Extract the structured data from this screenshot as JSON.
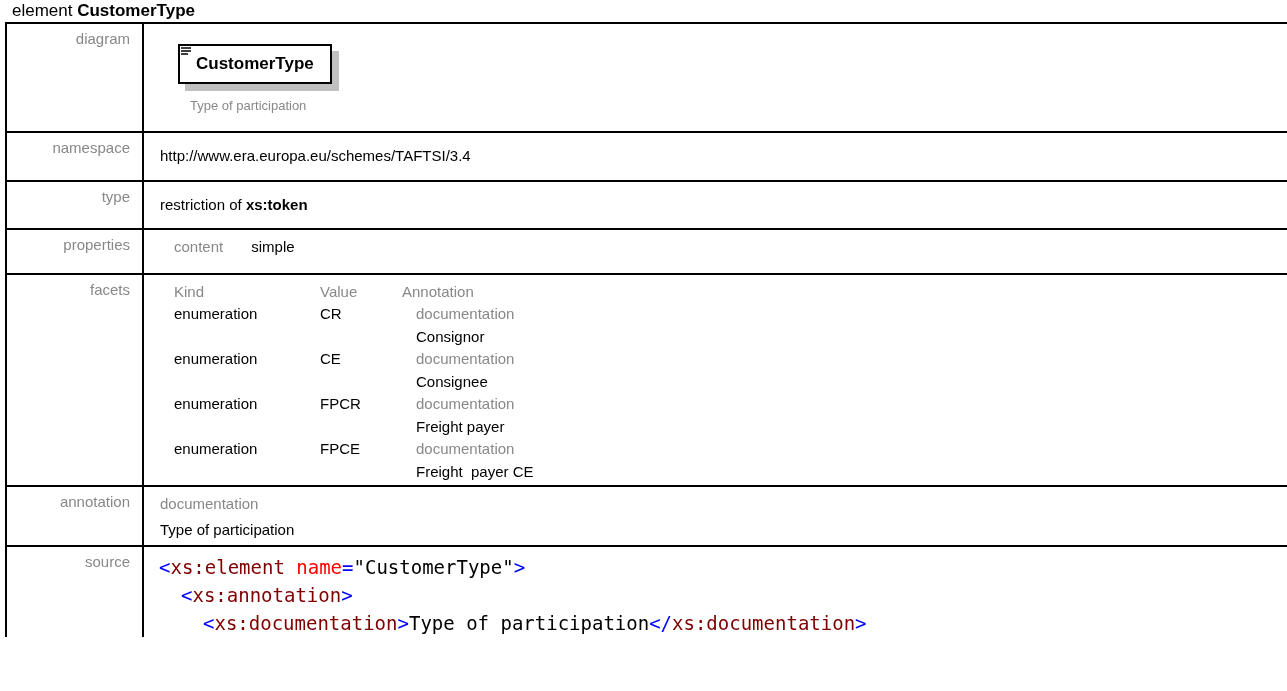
{
  "heading": "element **CustomerType**",
  "rows": [
    {
      "kind": "diagram",
      "label": "diagram",
      "element": "CustomerType",
      "caption": "Type of participation"
    },
    {
      "kind": "text",
      "label": "namespace",
      "value": "http://www.era.europa.eu/schemes/TAFTSI/3.4"
    },
    {
      "kind": "text",
      "label": "type",
      "value": "restriction of **xs:token**"
    },
    {
      "kind": "properties",
      "label": "properties",
      "name": "content",
      "value": "simple"
    },
    {
      "kind": "facets",
      "label": "facets",
      "columns": [
        "Kind",
        "Value",
        "Annotation"
      ],
      "items": [
        {
          "kind": "enumeration",
          "value": "CR",
          "annotation_label": "documentation",
          "annotation": "Consignor"
        },
        {
          "kind": "enumeration",
          "value": "CE",
          "annotation_label": "documentation",
          "annotation": "Consignee"
        },
        {
          "kind": "enumeration",
          "value": "FPCR",
          "annotation_label": "documentation",
          "annotation": "Freight payer"
        },
        {
          "kind": "enumeration",
          "value": "FPCE",
          "annotation_label": "documentation",
          "annotation": "Freight  payer CE"
        }
      ]
    },
    {
      "kind": "annotation",
      "label": "annotation",
      "name": "documentation",
      "value": "Type of participation"
    },
    {
      "kind": "source",
      "label": "source",
      "lines": [
        {
          "tokens": [
            {
              "kind": "bracket",
              "text": "<"
            },
            {
              "kind": "tag",
              "text": "xs:element "
            },
            {
              "kind": "attr",
              "text": "name"
            },
            {
              "kind": "bracket",
              "text": "="
            },
            {
              "kind": "value",
              "text": "\"CustomerType\""
            },
            {
              "kind": "bracket",
              "text": ">"
            }
          ],
          "children": [
            {
              "tokens": [
                {
                  "kind": "bracket",
                  "text": "<"
                },
                {
                  "kind": "tag",
                  "text": "xs:annotation"
                },
                {
                  "kind": "bracket",
                  "text": ">"
                }
              ],
              "children": [
                {
                  "tokens": [
                    {
                      "kind": "bracket",
                      "text": "<"
                    },
                    {
                      "kind": "tag",
                      "text": "xs:documentation"
                    },
                    {
                      "kind": "bracket",
                      "text": ">"
                    },
                    {
                      "kind": "value",
                      "text": "Type of participation"
                    },
                    {
                      "kind": "bracket",
                      "text": "</"
                    },
                    {
                      "kind": "tag",
                      "text": "xs:documentation"
                    },
                    {
                      "kind": "bracket",
                      "text": ">"
                    }
                  ]
                }
              ]
            }
          ]
        }
      ]
    }
  ]
}
